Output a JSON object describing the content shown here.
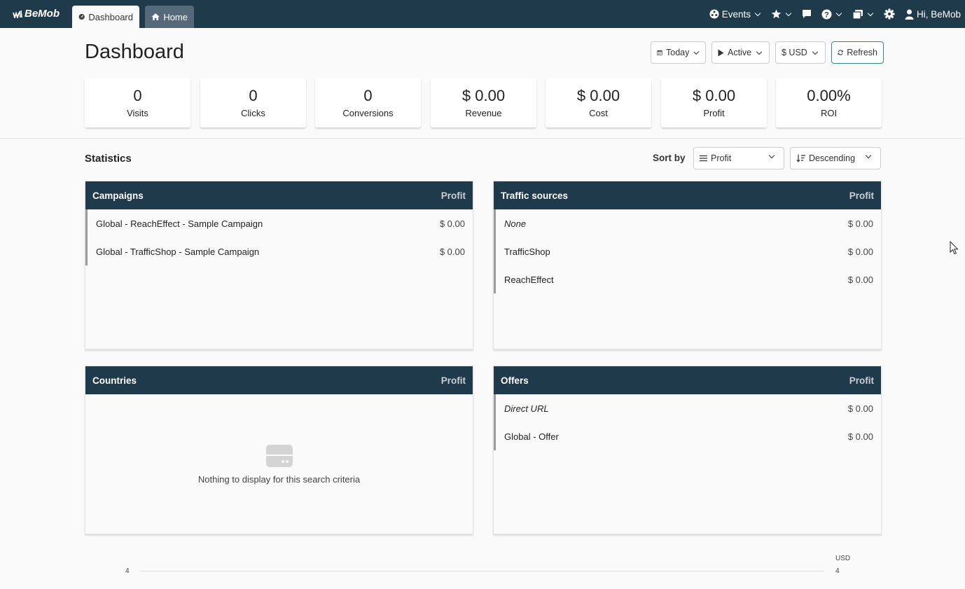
{
  "topbar": {
    "logo": "BeMob",
    "tabs": [
      {
        "label": "Dashboard",
        "active": true
      },
      {
        "label": "Home",
        "active": false
      }
    ],
    "nav": {
      "events": "Events",
      "user": "Hi, BeMob"
    },
    "colors": {
      "bar": "#1f3a4b",
      "home_tab": "#56697a"
    }
  },
  "header": {
    "title": "Dashboard",
    "date_filter": "Today",
    "status_filter": "Active",
    "currency": "$ USD",
    "refresh": "Refresh"
  },
  "metrics": [
    {
      "value": "0",
      "label": "Visits"
    },
    {
      "value": "0",
      "label": "Clicks"
    },
    {
      "value": "0",
      "label": "Conversions"
    },
    {
      "value": "$ 0.00",
      "label": "Revenue"
    },
    {
      "value": "$ 0.00",
      "label": "Cost"
    },
    {
      "value": "$ 0.00",
      "label": "Profit"
    },
    {
      "value": "0.00%",
      "label": "ROI"
    }
  ],
  "statistics": {
    "title": "Statistics",
    "sort_by_label": "Sort by",
    "sort_field": "Profit",
    "sort_order": "Descending"
  },
  "panels": {
    "campaigns": {
      "title": "Campaigns",
      "column": "Profit",
      "rows": [
        {
          "name": "Global - ReachEffect - Sample Campaign",
          "value": "$ 0.00"
        },
        {
          "name": "Global - TrafficShop - Sample Campaign",
          "value": "$ 0.00"
        }
      ]
    },
    "traffic_sources": {
      "title": "Traffic sources",
      "column": "Profit",
      "rows": [
        {
          "name": "None",
          "value": "$ 0.00"
        },
        {
          "name": "TrafficShop",
          "value": "$ 0.00"
        },
        {
          "name": "ReachEffect",
          "value": "$ 0.00"
        }
      ]
    },
    "countries": {
      "title": "Countries",
      "column": "Profit",
      "empty_message": "Nothing to display for this search criteria"
    },
    "offers": {
      "title": "Offers",
      "column": "Profit",
      "rows": [
        {
          "name": "Direct URL",
          "value": "$ 0.00"
        },
        {
          "name": "Global - Offer",
          "value": "$ 0.00"
        }
      ]
    }
  },
  "chart": {
    "unit": "USD",
    "left_tick": "4",
    "right_tick": "4"
  }
}
